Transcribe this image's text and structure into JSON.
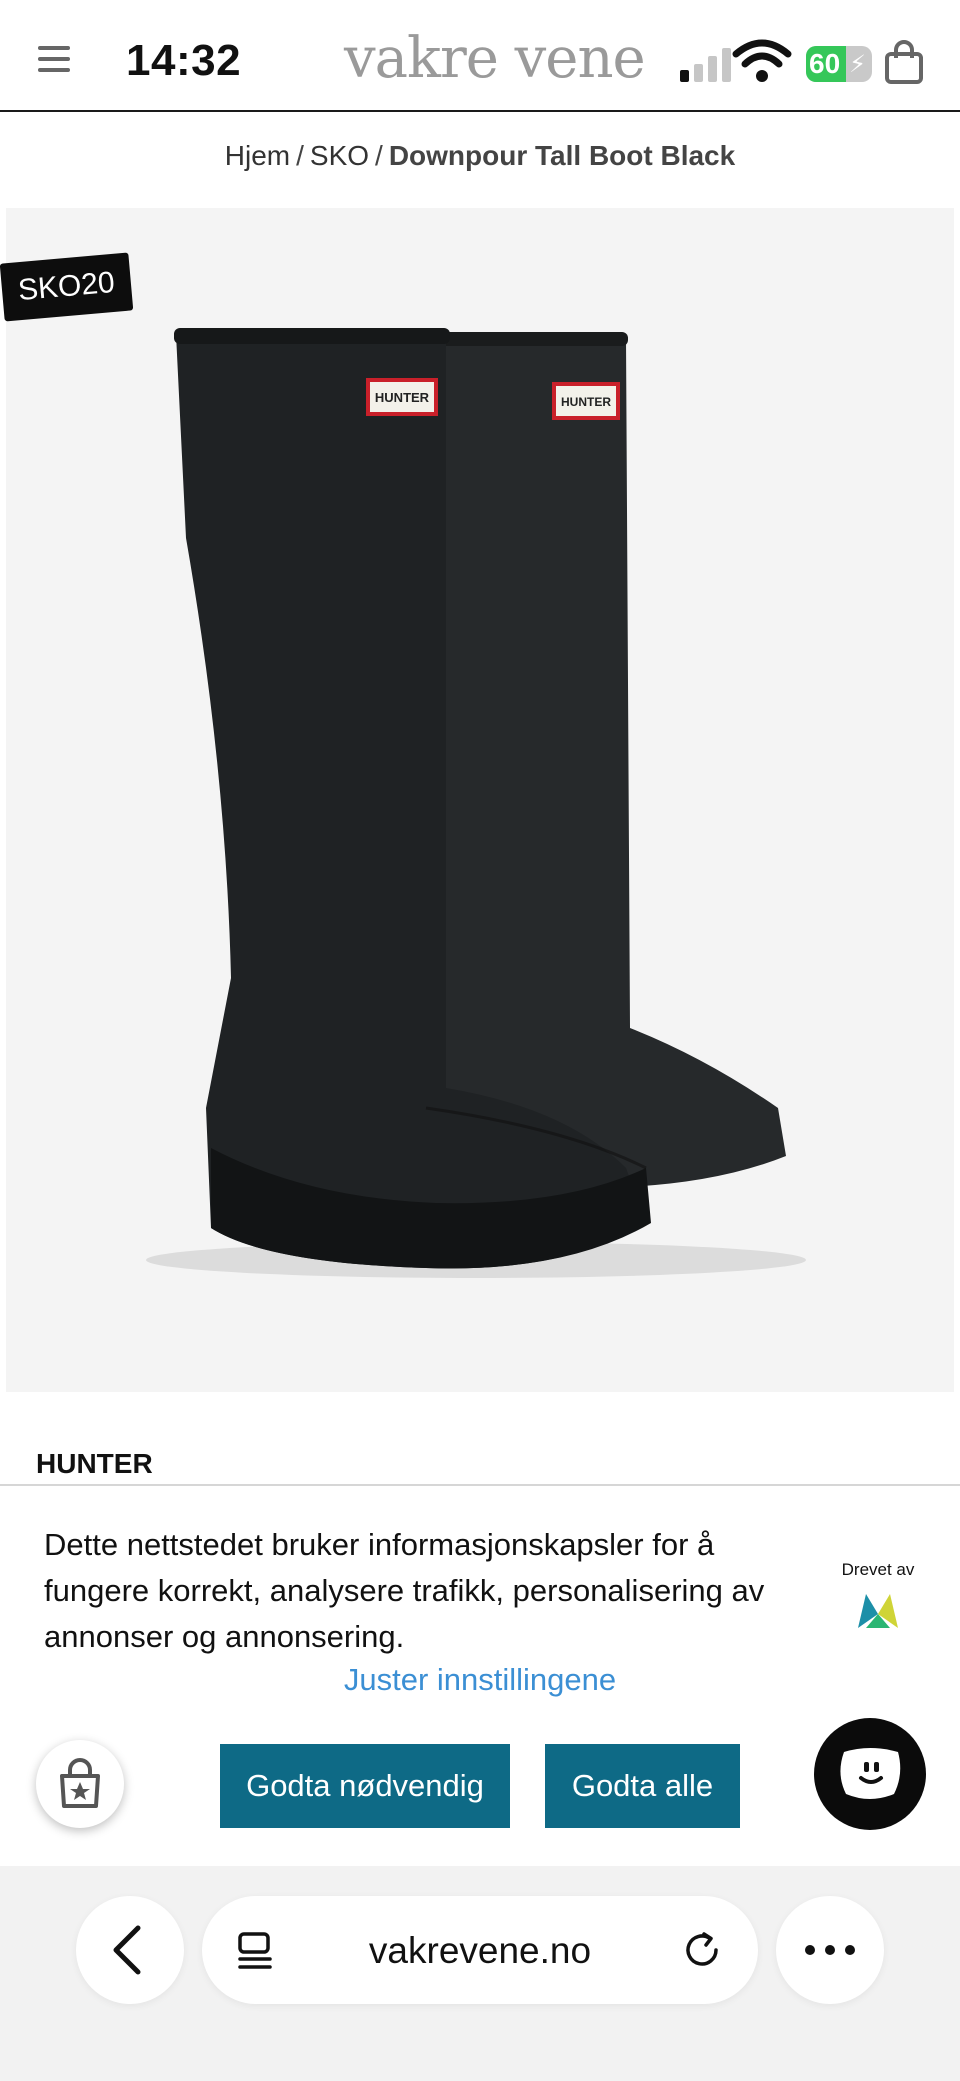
{
  "status_bar": {
    "time": "14:32",
    "battery_percent": "60",
    "battery_level": 0.6,
    "battery_color": "#35c759"
  },
  "header": {
    "logo_text": "vakre vene",
    "menu_icon": "hamburger-menu-icon",
    "cart_icon": "shopping-bag-icon"
  },
  "breadcrumb": {
    "items": [
      "Hjem",
      "SKO"
    ],
    "separator": "/",
    "current": "Downpour Tall Boot Black"
  },
  "product": {
    "promo_code": "SKO20",
    "brand": "HUNTER",
    "image_label": "HUNTER",
    "image_background": "#f4f4f4",
    "product_color": "#1e2022"
  },
  "cookie_banner": {
    "text": "Dette nettstedet bruker informasjonskapsler for å fungere korrekt, analysere trafikk, personalisering av annonser og annonsering.",
    "powered_by": "Drevet av",
    "adjust_link": "Juster innstillingene",
    "accept_necessary": "Godta nødvendig",
    "accept_all": "Godta alle",
    "button_color": "#0e6a86",
    "link_color": "#3b8fd4"
  },
  "browser": {
    "url": "vakrevene.no",
    "back_icon": "chevron-left-icon",
    "tabs_icon": "reader-icon",
    "reload_icon": "reload-icon",
    "more_icon": "more-dots-icon"
  }
}
